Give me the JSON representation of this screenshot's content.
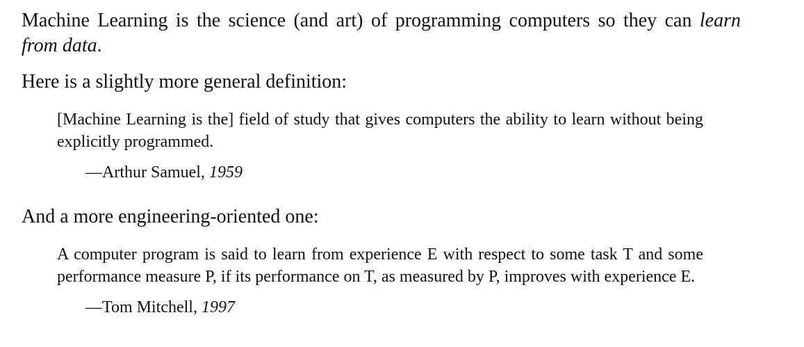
{
  "definition": {
    "lead": "Machine Learning is the science (and art) of programming computers so they can ",
    "emphasis": "learn from data",
    "end": "."
  },
  "intro_general": "Here is a slightly more general definition:",
  "quote_samuel": {
    "text": "[Machine Learning is the] field of study that gives computers the ability to learn without being explicitly programmed.",
    "attribution_name": "—Arthur Samuel, ",
    "attribution_year": "1959"
  },
  "intro_engineering": "And a more engineering-oriented one:",
  "quote_mitchell": {
    "text": "A computer program is said to learn from experience E with respect to some task T and some performance measure P, if its performance on T, as measured by P, improves with experience E.",
    "attribution_name": "—Tom Mitchell, ",
    "attribution_year": "1997"
  }
}
